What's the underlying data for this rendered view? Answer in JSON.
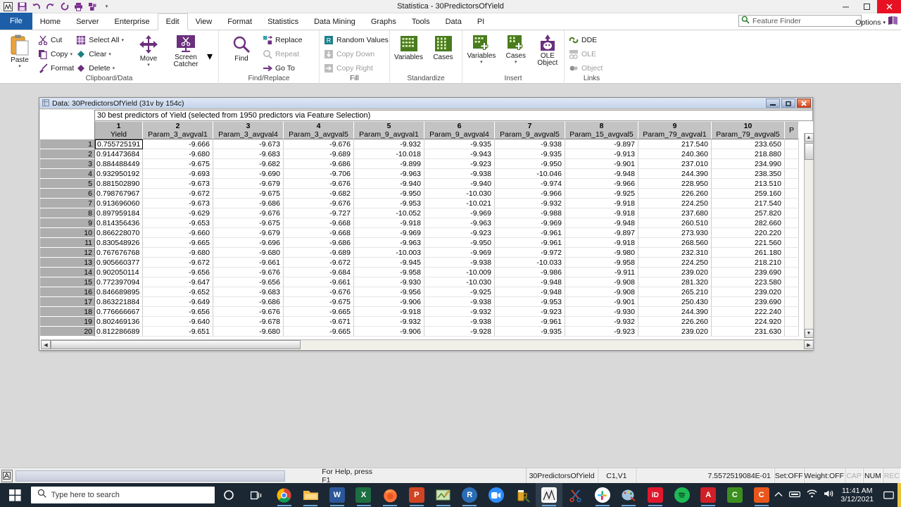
{
  "titlebar": {
    "title": "Statistica - 30PredictorsOfYield",
    "quick_access": [
      "statistica-logo-icon",
      "save-icon",
      "undo-icon",
      "redo-icon",
      "refresh-icon",
      "print-icon",
      "export-icon",
      "customize-caret-icon"
    ],
    "minimize": "─",
    "maximize": "☐",
    "close": "✕"
  },
  "tabs": [
    {
      "label": "File",
      "state": "file"
    },
    {
      "label": "Home",
      "state": "normal"
    },
    {
      "label": "Server",
      "state": "normal"
    },
    {
      "label": "Enterprise",
      "state": "normal"
    },
    {
      "label": "Edit",
      "state": "active"
    },
    {
      "label": "View",
      "state": "normal"
    },
    {
      "label": "Format",
      "state": "normal"
    },
    {
      "label": "Statistics",
      "state": "normal"
    },
    {
      "label": "Data Mining",
      "state": "normal"
    },
    {
      "label": "Graphs",
      "state": "normal"
    },
    {
      "label": "Tools",
      "state": "normal"
    },
    {
      "label": "Data",
      "state": "normal"
    },
    {
      "label": "PI",
      "state": "normal"
    }
  ],
  "feature_finder": {
    "placeholder": "Feature Finder",
    "icon": "search-icon"
  },
  "options": {
    "label": "Options",
    "caret": "▾"
  },
  "ribbon": {
    "groups": [
      {
        "title": "Clipboard/Data",
        "big": [
          {
            "label": "Paste",
            "caret": "▾",
            "icon": "paste-icon"
          }
        ],
        "columns": [
          [
            {
              "label": "Cut",
              "icon": "cut-icon",
              "caret": "",
              "disabled": false
            },
            {
              "label": "Copy",
              "icon": "copy-icon",
              "caret": "▾",
              "disabled": false
            },
            {
              "label": "Format",
              "icon": "format-painter-icon",
              "caret": "",
              "disabled": false
            }
          ],
          [
            {
              "label": "Select All",
              "icon": "select-all-icon",
              "caret": "▾",
              "disabled": false
            },
            {
              "label": "Clear",
              "icon": "clear-icon",
              "caret": "▾",
              "disabled": false
            },
            {
              "label": "Delete",
              "icon": "delete-icon",
              "caret": "▾",
              "disabled": false
            }
          ]
        ],
        "big2": [
          {
            "label": "Move",
            "caret": "▾",
            "icon": "move-icon"
          },
          {
            "label": "Screen Catcher",
            "caret": "▾",
            "icon": "screen-catcher-icon"
          }
        ]
      },
      {
        "title": "Find/Replace",
        "big": [
          {
            "label": "Find",
            "caret": "",
            "icon": "find-icon"
          }
        ],
        "columns": [
          [
            {
              "label": "Replace",
              "icon": "replace-icon",
              "caret": "",
              "disabled": false
            },
            {
              "label": "Repeat",
              "icon": "repeat-icon",
              "caret": "",
              "disabled": true
            },
            {
              "label": "Go To",
              "icon": "goto-icon",
              "caret": "",
              "disabled": false
            }
          ]
        ]
      },
      {
        "title": "Fill",
        "columns": [
          [
            {
              "label": "Random Values",
              "icon": "random-values-icon",
              "caret": "",
              "disabled": false
            },
            {
              "label": "Copy Down",
              "icon": "copy-down-icon",
              "caret": "",
              "disabled": true
            },
            {
              "label": "Copy Right",
              "icon": "copy-right-icon",
              "caret": "",
              "disabled": true
            }
          ]
        ]
      },
      {
        "title": "Standardize",
        "big2": [
          {
            "label": "Variables",
            "caret": "",
            "icon": "variables-icon"
          },
          {
            "label": "Cases",
            "caret": "",
            "icon": "cases-icon"
          }
        ]
      },
      {
        "title": "Insert",
        "big2": [
          {
            "label": "Variables",
            "caret": "▾",
            "icon": "insert-variables-icon"
          },
          {
            "label": "Cases",
            "caret": "▾",
            "icon": "insert-cases-icon"
          },
          {
            "label": "OLE Object",
            "caret": "",
            "icon": "ole-object-icon"
          }
        ]
      },
      {
        "title": "Links",
        "columns": [
          [
            {
              "label": "DDE",
              "icon": "dde-icon",
              "caret": "",
              "disabled": false
            },
            {
              "label": "OLE",
              "icon": "ole-icon",
              "caret": "",
              "disabled": true
            },
            {
              "label": "Object",
              "icon": "object-icon",
              "caret": "",
              "disabled": true
            }
          ]
        ]
      }
    ]
  },
  "data_window": {
    "title": "Data: 30PredictorsOfYield (31v by 154c)",
    "caption": "30 best predictors of Yield (selected from 1950 predictors via Feature Selection)",
    "minimize": "─",
    "restore": "□",
    "close": "✕",
    "columns": [
      {
        "num": "1",
        "name": "Yield"
      },
      {
        "num": "2",
        "name": "Param_3_avgval1"
      },
      {
        "num": "3",
        "name": "Param_3_avgval4"
      },
      {
        "num": "4",
        "name": "Param_3_avgval5"
      },
      {
        "num": "5",
        "name": "Param_9_avgval1"
      },
      {
        "num": "6",
        "name": "Param_9_avgval4"
      },
      {
        "num": "7",
        "name": "Param_9_avgval5"
      },
      {
        "num": "8",
        "name": "Param_15_avgval5"
      },
      {
        "num": "9",
        "name": "Param_79_avgval1"
      },
      {
        "num": "10",
        "name": "Param_79_avgval5"
      },
      {
        "num": "",
        "name": "P"
      }
    ],
    "rows": [
      {
        "n": "1",
        "cells": [
          "0.755725191",
          "-9.666",
          "-9.673",
          "-9.676",
          "-9.932",
          "-9.935",
          "-9.938",
          "-9.897",
          "217.540",
          "233.650",
          ""
        ]
      },
      {
        "n": "2",
        "cells": [
          "0.914473684",
          "-9.680",
          "-9.683",
          "-9.689",
          "-10.018",
          "-9.943",
          "-9.935",
          "-9.913",
          "240.360",
          "218.880",
          ""
        ]
      },
      {
        "n": "3",
        "cells": [
          "0.884488449",
          "-9.675",
          "-9.682",
          "-9.686",
          "-9.899",
          "-9.923",
          "-9.950",
          "-9.901",
          "237.010",
          "234.990",
          ""
        ]
      },
      {
        "n": "4",
        "cells": [
          "0.932950192",
          "-9.693",
          "-9.690",
          "-9.706",
          "-9.963",
          "-9.938",
          "-10.046",
          "-9.948",
          "244.390",
          "238.350",
          ""
        ]
      },
      {
        "n": "5",
        "cells": [
          "0.881502890",
          "-9.673",
          "-9.679",
          "-9.676",
          "-9.940",
          "-9.940",
          "-9.974",
          "-9.966",
          "228.950",
          "213.510",
          ""
        ]
      },
      {
        "n": "6",
        "cells": [
          "0.798767967",
          "-9.672",
          "-9.675",
          "-9.682",
          "-9.950",
          "-10.030",
          "-9.966",
          "-9.925",
          "226.260",
          "259.160",
          ""
        ]
      },
      {
        "n": "7",
        "cells": [
          "0.913696060",
          "-9.673",
          "-9.686",
          "-9.676",
          "-9.953",
          "-10.021",
          "-9.932",
          "-9.918",
          "224.250",
          "217.540",
          ""
        ]
      },
      {
        "n": "8",
        "cells": [
          "0.897959184",
          "-9.629",
          "-9.676",
          "-9.727",
          "-10.052",
          "-9.969",
          "-9.988",
          "-9.918",
          "237.680",
          "257.820",
          ""
        ]
      },
      {
        "n": "9",
        "cells": [
          "0.814356436",
          "-9.653",
          "-9.675",
          "-9.668",
          "-9.918",
          "-9.963",
          "-9.969",
          "-9.948",
          "260.510",
          "282.660",
          ""
        ]
      },
      {
        "n": "10",
        "cells": [
          "0.866228070",
          "-9.660",
          "-9.679",
          "-9.668",
          "-9.969",
          "-9.923",
          "-9.961",
          "-9.897",
          "273.930",
          "220.220",
          ""
        ]
      },
      {
        "n": "11",
        "cells": [
          "0.830548926",
          "-9.665",
          "-9.696",
          "-9.686",
          "-9.963",
          "-9.950",
          "-9.961",
          "-9.918",
          "268.560",
          "221.560",
          ""
        ]
      },
      {
        "n": "12",
        "cells": [
          "0.767676768",
          "-9.680",
          "-9.680",
          "-9.689",
          "-10.003",
          "-9.969",
          "-9.972",
          "-9.980",
          "232.310",
          "261.180",
          ""
        ]
      },
      {
        "n": "13",
        "cells": [
          "0.905660377",
          "-9.672",
          "-9.661",
          "-9.672",
          "-9.945",
          "-9.938",
          "-10.033",
          "-9.958",
          "224.250",
          "218.210",
          ""
        ]
      },
      {
        "n": "14",
        "cells": [
          "0.902050114",
          "-9.656",
          "-9.676",
          "-9.684",
          "-9.958",
          "-10.009",
          "-9.986",
          "-9.911",
          "239.020",
          "239.690",
          ""
        ]
      },
      {
        "n": "15",
        "cells": [
          "0.772397094",
          "-9.647",
          "-9.656",
          "-9.661",
          "-9.930",
          "-10.030",
          "-9.948",
          "-9.908",
          "281.320",
          "223.580",
          ""
        ]
      },
      {
        "n": "16",
        "cells": [
          "0.846689895",
          "-9.652",
          "-9.683",
          "-9.676",
          "-9.956",
          "-9.925",
          "-9.948",
          "-9.908",
          "265.210",
          "239.020",
          ""
        ]
      },
      {
        "n": "17",
        "cells": [
          "0.863221884",
          "-9.649",
          "-9.686",
          "-9.675",
          "-9.906",
          "-9.938",
          "-9.953",
          "-9.901",
          "250.430",
          "239.690",
          ""
        ]
      },
      {
        "n": "18",
        "cells": [
          "0.776666667",
          "-9.656",
          "-9.676",
          "-9.665",
          "-9.918",
          "-9.932",
          "-9.923",
          "-9.930",
          "244.390",
          "222.240",
          ""
        ]
      },
      {
        "n": "19",
        "cells": [
          "0.802469136",
          "-9.640",
          "-9.678",
          "-9.671",
          "-9.932",
          "-9.938",
          "-9.961",
          "-9.932",
          "226.260",
          "224.920",
          ""
        ]
      },
      {
        "n": "20",
        "cells": [
          "0.812286689",
          "-9.651",
          "-9.680",
          "-9.665",
          "-9.906",
          "-9.928",
          "-9.935",
          "-9.923",
          "239.020",
          "231.630",
          ""
        ]
      }
    ]
  },
  "statusbar": {
    "icon": "ansi-mode-icon",
    "help": "For Help, press F1",
    "dataset": "30PredictorsOfYield",
    "cell_ref": "C1,V1",
    "value": "7.5572519084E-01",
    "set": "Set:OFF",
    "weight": "Weight:OFF",
    "cap": "CAP",
    "num": "NUM",
    "rec": "REC"
  },
  "taskbar": {
    "start": "windows-start-icon",
    "search_placeholder": "Type here to search",
    "cortana": "cortana-icon",
    "taskview": "task-view-icon",
    "apps": [
      {
        "name": "chrome",
        "glyph": "",
        "bg": "#ffffff"
      },
      {
        "name": "file-explorer",
        "glyph": "",
        "bg": "#f5b946"
      },
      {
        "name": "word",
        "glyph": "W",
        "bg": "#2b579a"
      },
      {
        "name": "excel",
        "glyph": "X",
        "bg": "#1d6f42"
      },
      {
        "name": "firefox",
        "glyph": "",
        "bg": "#e8661b"
      },
      {
        "name": "powerpoint",
        "glyph": "P",
        "bg": "#d04423"
      },
      {
        "name": "notes",
        "glyph": "",
        "bg": "#9bc47a"
      },
      {
        "name": "r-studio",
        "glyph": "R",
        "bg": "#2a6db5"
      },
      {
        "name": "zoom",
        "glyph": "",
        "bg": "#2d8cff"
      },
      {
        "name": "beer-app",
        "glyph": "",
        "bg": "#e0a526"
      },
      {
        "name": "statistica",
        "glyph": "",
        "bg": "#ffffff"
      },
      {
        "name": "snip-tool",
        "glyph": "",
        "bg": "#d24127"
      },
      {
        "name": "slack",
        "glyph": "",
        "bg": "#ffffff"
      },
      {
        "name": "paint-app",
        "glyph": "",
        "bg": "#8fb8d8"
      },
      {
        "name": "id-app",
        "glyph": "iD",
        "bg": "#e0182d"
      },
      {
        "name": "spotify",
        "glyph": "",
        "bg": "#1db954"
      },
      {
        "name": "acrobat",
        "glyph": "A",
        "bg": "#d01f26"
      },
      {
        "name": "camtasia",
        "glyph": "C",
        "bg": "#3b8f1e"
      },
      {
        "name": "camtasia-studio",
        "glyph": "C",
        "bg": "#e8561c"
      }
    ],
    "tray": [
      "show-hidden-icons-chevron",
      "hardware-icon",
      "wifi-icon",
      "volume-icon"
    ],
    "time": "11:41 AM",
    "date": "3/12/2021",
    "action_center": "notification-icon"
  }
}
